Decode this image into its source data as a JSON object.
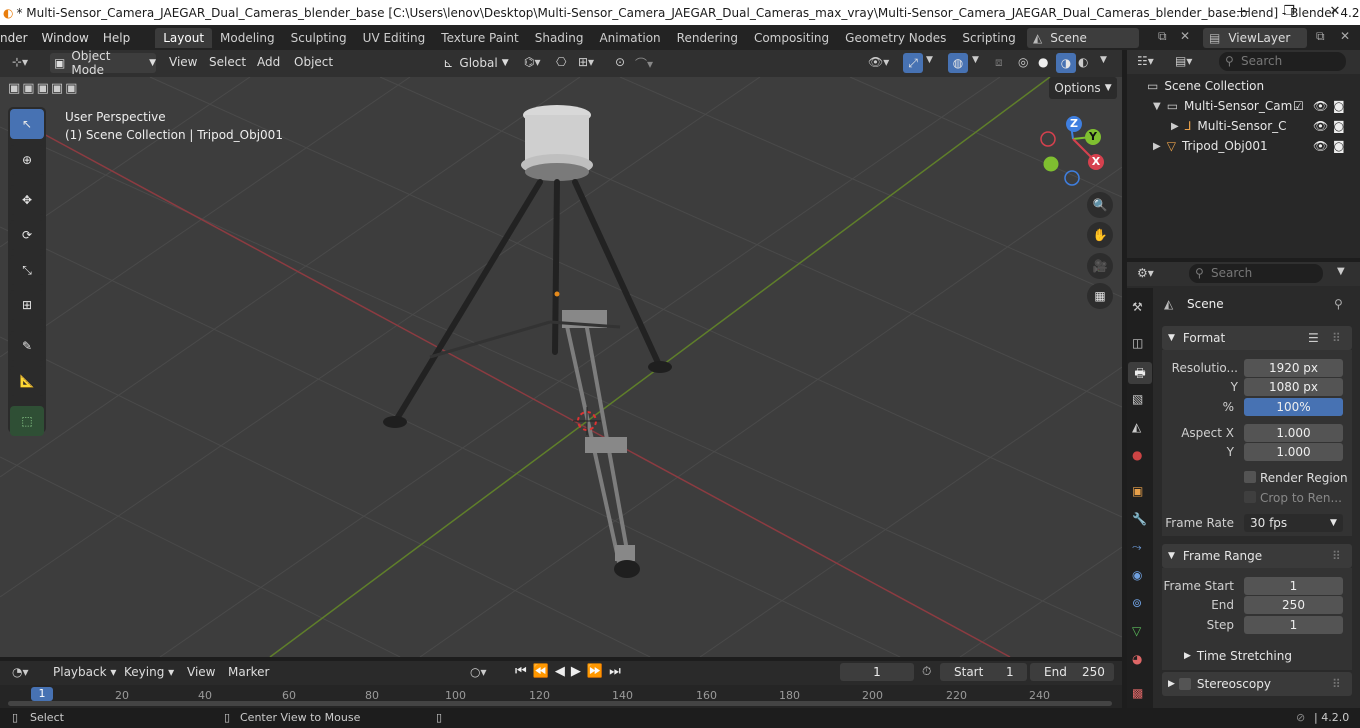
{
  "title_bar": {
    "title": "* Multi-Sensor_Camera_JAEGAR_Dual_Cameras_blender_base [C:\\Users\\lenov\\Desktop\\Multi-Sensor_Camera_JAEGAR_Dual_Cameras_max_vray\\Multi-Sensor_Camera_JAEGAR_Dual_Cameras_blender_base.blend] - Blender 4.2",
    "minimize": "—",
    "maximize": "❐",
    "close": "✕"
  },
  "menu": [
    "nder",
    "Window",
    "Help"
  ],
  "workspaces": [
    "Layout",
    "Modeling",
    "Sculpting",
    "UV Editing",
    "Texture Paint",
    "Shading",
    "Animation",
    "Rendering",
    "Compositing",
    "Geometry Nodes",
    "Scripting"
  ],
  "add_workspace": "+",
  "scene": {
    "name": "Scene",
    "view_layer": "ViewLayer"
  },
  "viewport_header": {
    "mode": "Object Mode",
    "menus": [
      "View",
      "Select",
      "Add",
      "Object"
    ],
    "orientation": "Global",
    "options": "Options"
  },
  "viewport": {
    "perspective": "User Perspective",
    "collection_info": "(1) Scene Collection | Tripod_Obj001",
    "gizmo": {
      "z": "Z",
      "y": "Y",
      "x": "X"
    }
  },
  "outliner": {
    "search_placeholder": "Search",
    "root": "Scene Collection",
    "items": [
      "Multi-Sensor_Cam",
      "Multi-Sensor_C",
      "Tripod_Obj001"
    ]
  },
  "properties": {
    "search_placeholder": "Search",
    "context": "Scene",
    "format_section": "Format",
    "resolution_x_label": "Resolutio...",
    "resolution_x": "1920 px",
    "resolution_y_label": "Y",
    "resolution_y": "1080 px",
    "resolution_pct_label": "%",
    "resolution_pct": "100%",
    "aspect_x_label": "Aspect X",
    "aspect_x": "1.000",
    "aspect_y_label": "Y",
    "aspect_y": "1.000",
    "render_region": "Render Region",
    "crop": "Crop to Ren...",
    "frame_rate_label": "Frame Rate",
    "frame_rate": "30 fps",
    "frame_range_section": "Frame Range",
    "frame_start_label": "Frame Start",
    "frame_start": "1",
    "end_label": "End",
    "end": "250",
    "step_label": "Step",
    "step": "1",
    "time_stretching": "Time Stretching",
    "stereoscopy": "Stereoscopy"
  },
  "timeline": {
    "menus": [
      "Playback",
      "Keying",
      "View",
      "Marker"
    ],
    "current_frame": "1",
    "start_label": "Start",
    "start": "1",
    "end_label": "End",
    "end": "250",
    "ticks": [
      "1",
      "20",
      "40",
      "60",
      "80",
      "100",
      "120",
      "140",
      "160",
      "180",
      "200",
      "220",
      "240"
    ]
  },
  "status_bar": {
    "select": "Select",
    "center_view": "Center View to Mouse",
    "version": "4.2.0"
  },
  "colors": {
    "accent": "#4772b3",
    "x_axis": "#d6414e",
    "y_axis": "#7fbf30",
    "z_axis": "#3f7fe0"
  }
}
